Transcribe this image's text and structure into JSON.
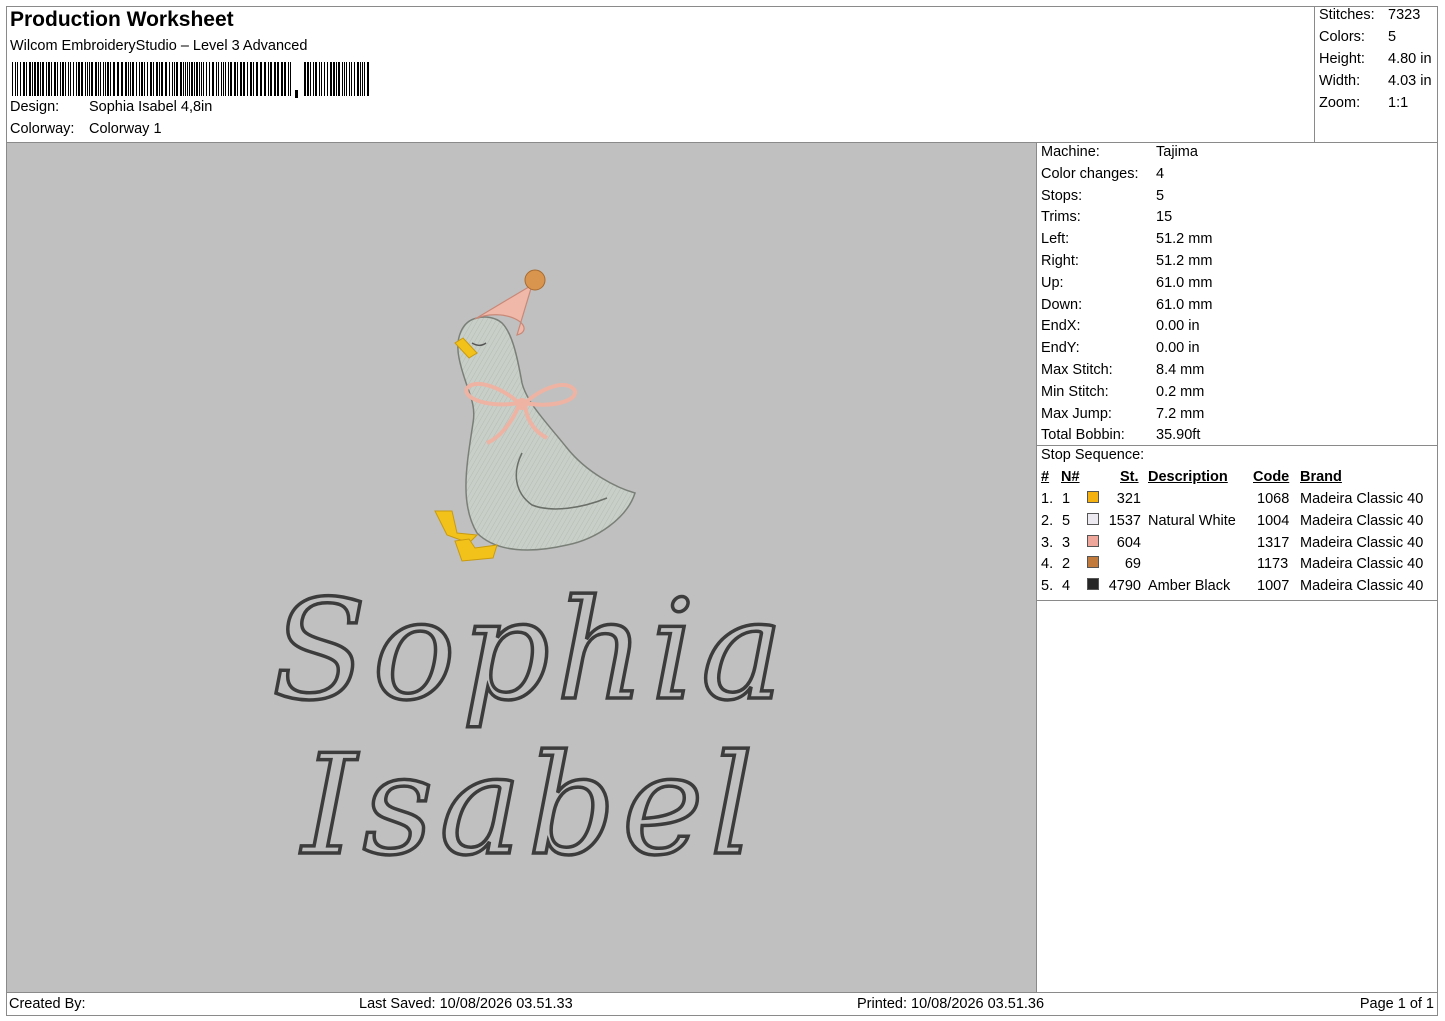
{
  "header": {
    "title": "Production Worksheet",
    "subtitle": "Wilcom EmbroideryStudio – Level 3 Advanced",
    "design_label": "Design:",
    "design_value": "Sophia Isabel 4,8in",
    "colorway_label": "Colorway:",
    "colorway_value": "Colorway 1"
  },
  "summary": [
    {
      "label": "Stitches:",
      "value": "7323"
    },
    {
      "label": "Colors:",
      "value": "5"
    },
    {
      "label": "Height:",
      "value": "4.80 in"
    },
    {
      "label": "Width:",
      "value": "4.03 in"
    },
    {
      "label": "Zoom:",
      "value": "1:1"
    }
  ],
  "machine": [
    {
      "label": "Machine:",
      "value": "Tajima"
    },
    {
      "label": "Color changes:",
      "value": "4"
    },
    {
      "label": "Stops:",
      "value": "5"
    },
    {
      "label": "Trims:",
      "value": "15"
    },
    {
      "label": "Left:",
      "value": "51.2 mm"
    },
    {
      "label": "Right:",
      "value": "51.2 mm"
    },
    {
      "label": "Up:",
      "value": "61.0 mm"
    },
    {
      "label": "Down:",
      "value": "61.0 mm"
    },
    {
      "label": "EndX:",
      "value": "0.00 in"
    },
    {
      "label": "EndY:",
      "value": "0.00 in"
    },
    {
      "label": "Max Stitch:",
      "value": "8.4 mm"
    },
    {
      "label": "Min Stitch:",
      "value": "0.2 mm"
    },
    {
      "label": "Max Jump:",
      "value": "7.2 mm"
    },
    {
      "label": "Total Bobbin:",
      "value": "35.90ft"
    }
  ],
  "stop_sequence": {
    "title": "Stop Sequence:",
    "headers": {
      "num": "#",
      "needle": "N#",
      "stitches": "St.",
      "description": "Description",
      "code": "Code",
      "brand": "Brand"
    },
    "rows": [
      {
        "num": "1.",
        "needle": "1",
        "color": "#f5b10e",
        "stitches": "321",
        "description": "",
        "code": "1068",
        "brand": "Madeira Classic 40"
      },
      {
        "num": "2.",
        "needle": "5",
        "color": "#eceaf0",
        "stitches": "1537",
        "description": "Natural White",
        "code": "1004",
        "brand": "Madeira Classic 40"
      },
      {
        "num": "3.",
        "needle": "3",
        "color": "#eea79a",
        "stitches": "604",
        "description": "",
        "code": "1317",
        "brand": "Madeira Classic 40"
      },
      {
        "num": "4.",
        "needle": "2",
        "color": "#c27a3c",
        "stitches": "69",
        "description": "",
        "code": "1173",
        "brand": "Madeira Classic 40"
      },
      {
        "num": "5.",
        "needle": "4",
        "color": "#262626",
        "stitches": "4790",
        "description": "Amber Black",
        "code": "1007",
        "brand": "Madeira Classic 40"
      }
    ]
  },
  "design_preview": {
    "text_line1": "Sophia",
    "text_line2": "Isabel",
    "background": "#c0c0c0",
    "thread_text": "#3c3c3c",
    "thread_body": "#c6cdc6",
    "thread_hat": "#f0b8a8",
    "thread_pompom": "#d9954e",
    "thread_beak": "#f3c21a"
  },
  "footer": {
    "created_by": "Created By:",
    "last_saved": "Last Saved: 10/08/2026 03.51.33",
    "printed": "Printed: 10/08/2026 03.51.36",
    "page": "Page 1 of 1"
  }
}
